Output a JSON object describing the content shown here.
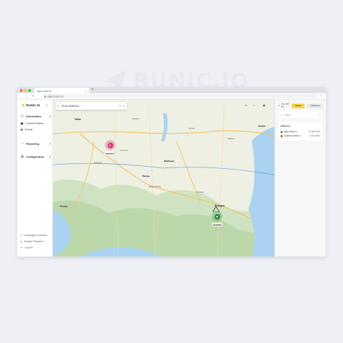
{
  "brand": {
    "name": "RUNIC.IO"
  },
  "browser": {
    "tab_title": "app.runic.io",
    "tab_close": "×",
    "new_tab": "+",
    "url": "app.runic.io",
    "menu": "⋮"
  },
  "sidebar": {
    "logo": "RUNIC.IO",
    "collapse": "«",
    "items": [
      {
        "label": "Information",
        "icon": "info-icon",
        "chevron": "▾"
      },
      {
        "label": "Current Position",
        "icon": "location-pin-icon"
      },
      {
        "label": "Events",
        "icon": "calendar-icon"
      },
      {
        "label": "Reporting",
        "icon": "chart-icon",
        "chevron": "▾"
      },
      {
        "label": "Configuration",
        "icon": "gear-icon",
        "chevron": "▾"
      }
    ],
    "footer": [
      {
        "label": "Datalogger Activation",
        "icon": "key-icon"
      },
      {
        "label": "Change Password",
        "icon": "lock-icon"
      },
      {
        "label": "Log out",
        "icon": "logout-icon"
      }
    ]
  },
  "map": {
    "search_placeholder": "Find address...",
    "cities": [
      "Milan",
      "Venice",
      "Genoa",
      "Parma",
      "Mantova",
      "Bologna",
      "Cremona",
      "Brescia",
      "Verona",
      "Padova",
      "Reggio Emilia",
      "Modena",
      "Piacenza"
    ],
    "markers": [
      {
        "label": "MARCIAS",
        "color": "#d6336c"
      },
      {
        "label": "MARONE",
        "color": "#2b8a3e"
      }
    ]
  },
  "right_panel": {
    "filter_label": "FILTER BY",
    "filter_options": [
      "Name",
      "Distance"
    ],
    "search_placeholder": "Filter...",
    "vehicles_title": "VEHICLE",
    "vehicles": [
      {
        "name": "Auto Demo 1",
        "speed": "37.68 Km/h",
        "color": "#2b8a3e"
      },
      {
        "name": "Camion Demo 1",
        "speed": "0.00 Km/h",
        "color": "#d6336c"
      }
    ]
  }
}
